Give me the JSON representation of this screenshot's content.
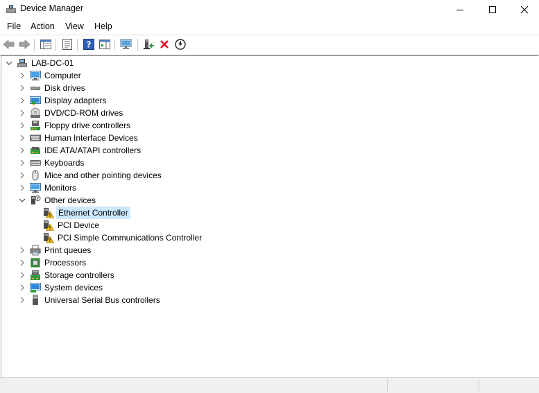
{
  "window": {
    "title": "Device Manager"
  },
  "menu": [
    "File",
    "Action",
    "View",
    "Help"
  ],
  "toolbar": [
    {
      "name": "back-icon"
    },
    {
      "name": "forward-icon"
    },
    {
      "name": "show-hide-console-tree-icon"
    },
    {
      "name": "properties-icon"
    },
    {
      "name": "help-icon"
    },
    {
      "name": "action-pane-icon"
    },
    {
      "name": "scan-hardware-icon"
    },
    {
      "name": "update-driver-icon"
    },
    {
      "name": "uninstall-device-icon"
    },
    {
      "name": "disable-device-icon"
    }
  ],
  "tree": {
    "root": "LAB-DC-01",
    "categories": [
      {
        "label": "Computer",
        "icon": "computer-icon",
        "expanded": false
      },
      {
        "label": "Disk drives",
        "icon": "disk-drive-icon",
        "expanded": false
      },
      {
        "label": "Display adapters",
        "icon": "display-adapter-icon",
        "expanded": false
      },
      {
        "label": "DVD/CD-ROM drives",
        "icon": "dvd-drive-icon",
        "expanded": false
      },
      {
        "label": "Floppy drive controllers",
        "icon": "floppy-controller-icon",
        "expanded": false
      },
      {
        "label": "Human Interface Devices",
        "icon": "hid-icon",
        "expanded": false
      },
      {
        "label": "IDE ATA/ATAPI controllers",
        "icon": "ide-controller-icon",
        "expanded": false
      },
      {
        "label": "Keyboards",
        "icon": "keyboard-icon",
        "expanded": false
      },
      {
        "label": "Mice and other pointing devices",
        "icon": "mouse-icon",
        "expanded": false
      },
      {
        "label": "Monitors",
        "icon": "monitor-icon",
        "expanded": false
      },
      {
        "label": "Other devices",
        "icon": "other-devices-icon",
        "expanded": true,
        "children": [
          {
            "label": "Ethernet Controller",
            "icon": "warning-device-icon",
            "selected": true
          },
          {
            "label": "PCI Device",
            "icon": "warning-device-icon",
            "selected": false
          },
          {
            "label": "PCI Simple Communications Controller",
            "icon": "warning-device-icon",
            "selected": false
          }
        ]
      },
      {
        "label": "Print queues",
        "icon": "printer-icon",
        "expanded": false
      },
      {
        "label": "Processors",
        "icon": "processor-icon",
        "expanded": false
      },
      {
        "label": "Storage controllers",
        "icon": "storage-controller-icon",
        "expanded": false
      },
      {
        "label": "System devices",
        "icon": "system-devices-icon",
        "expanded": false
      },
      {
        "label": "Universal Serial Bus controllers",
        "icon": "usb-icon",
        "expanded": false
      }
    ]
  },
  "colors": {
    "selection": "#cce8ff",
    "warning": "#f5c211",
    "accent": "#0078d7",
    "uninstall": "#e81123"
  }
}
